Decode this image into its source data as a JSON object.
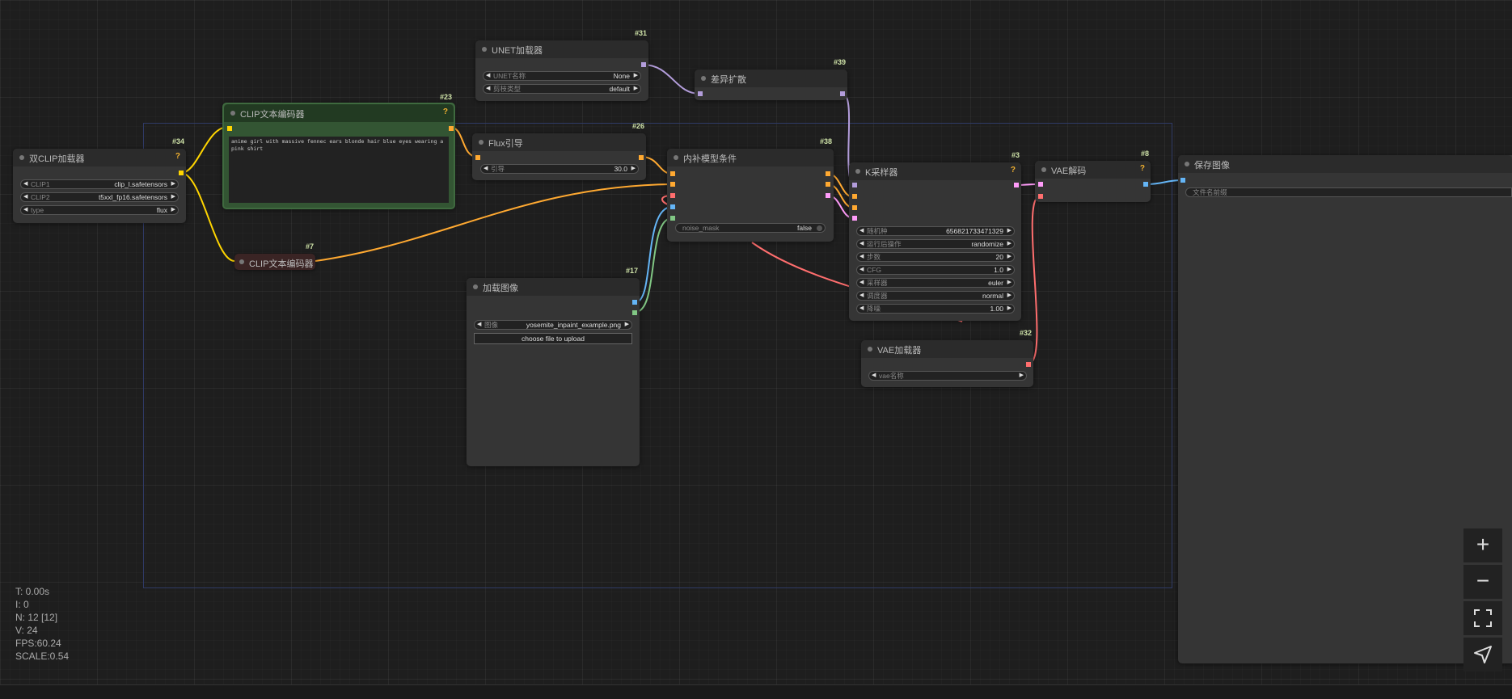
{
  "nodes": {
    "dual_clip": {
      "id": "#34",
      "title": "双CLIP加载器",
      "help": "?",
      "clip1_label": "CLIP1",
      "clip1_value": "clip_l.safetensors",
      "clip2_label": "CLIP2",
      "clip2_value": "t5xxl_fp16.safetensors",
      "type_label": "type",
      "type_value": "flux"
    },
    "clip_pos": {
      "id": "#23",
      "title": "CLIP文本编码器",
      "help": "?",
      "prompt": "anime girl with massive fennec ears blonde hair blue eyes wearing a pink shirt"
    },
    "clip_neg": {
      "id": "#7",
      "title": "CLIP文本编码器"
    },
    "unet": {
      "id": "#31",
      "title": "UNET加载器",
      "name_label": "UNET名称",
      "name_value": "None",
      "dtype_label": "剪枝类型",
      "dtype_value": "default"
    },
    "diff": {
      "id": "#39",
      "title": "差异扩散"
    },
    "flux": {
      "id": "#26",
      "title": "Flux引导",
      "guide_label": "引导",
      "guide_value": "30.0"
    },
    "inpaint": {
      "id": "#38",
      "title": "内补模型条件",
      "noise_label": "noise_mask",
      "noise_value": "false"
    },
    "load_image": {
      "id": "#17",
      "title": "加载图像",
      "image_label": "图像",
      "image_value": "yosemite_inpaint_example.png",
      "upload_label": "choose file to upload"
    },
    "ksampler": {
      "id": "#3",
      "title": "K采样器",
      "help": "?",
      "rows": [
        {
          "label": "随机种",
          "value": "656821733471329"
        },
        {
          "label": "运行后操作",
          "value": "randomize"
        },
        {
          "label": "步数",
          "value": "20"
        },
        {
          "label": "CFG",
          "value": "1.0"
        },
        {
          "label": "采样器",
          "value": "euler"
        },
        {
          "label": "调度器",
          "value": "normal"
        },
        {
          "label": "降噪",
          "value": "1.00"
        }
      ]
    },
    "vae_loader": {
      "id": "#32",
      "title": "VAE加载器",
      "name_label": "vae名称"
    },
    "vae_decode": {
      "id": "#8",
      "title": "VAE解码",
      "help": "?"
    },
    "save_image": {
      "title": "保存图像",
      "filename_label": "文件名前缀"
    }
  },
  "stats": {
    "t": "T: 0.00s",
    "i": "I: 0",
    "n": "N: 12 [12]",
    "v": "V: 24",
    "fps": "FPS:60.24",
    "scale": "SCALE:0.54"
  },
  "controls": {
    "zoom_in": "+",
    "zoom_out": "−"
  },
  "colors": {
    "clip": "#ffd500",
    "conditioning": "#ffa931",
    "model": "#b39ddb",
    "latent": "#ff9cf9",
    "vae": "#ff6e6e",
    "image": "#64b5f6",
    "mask": "#81c784"
  }
}
